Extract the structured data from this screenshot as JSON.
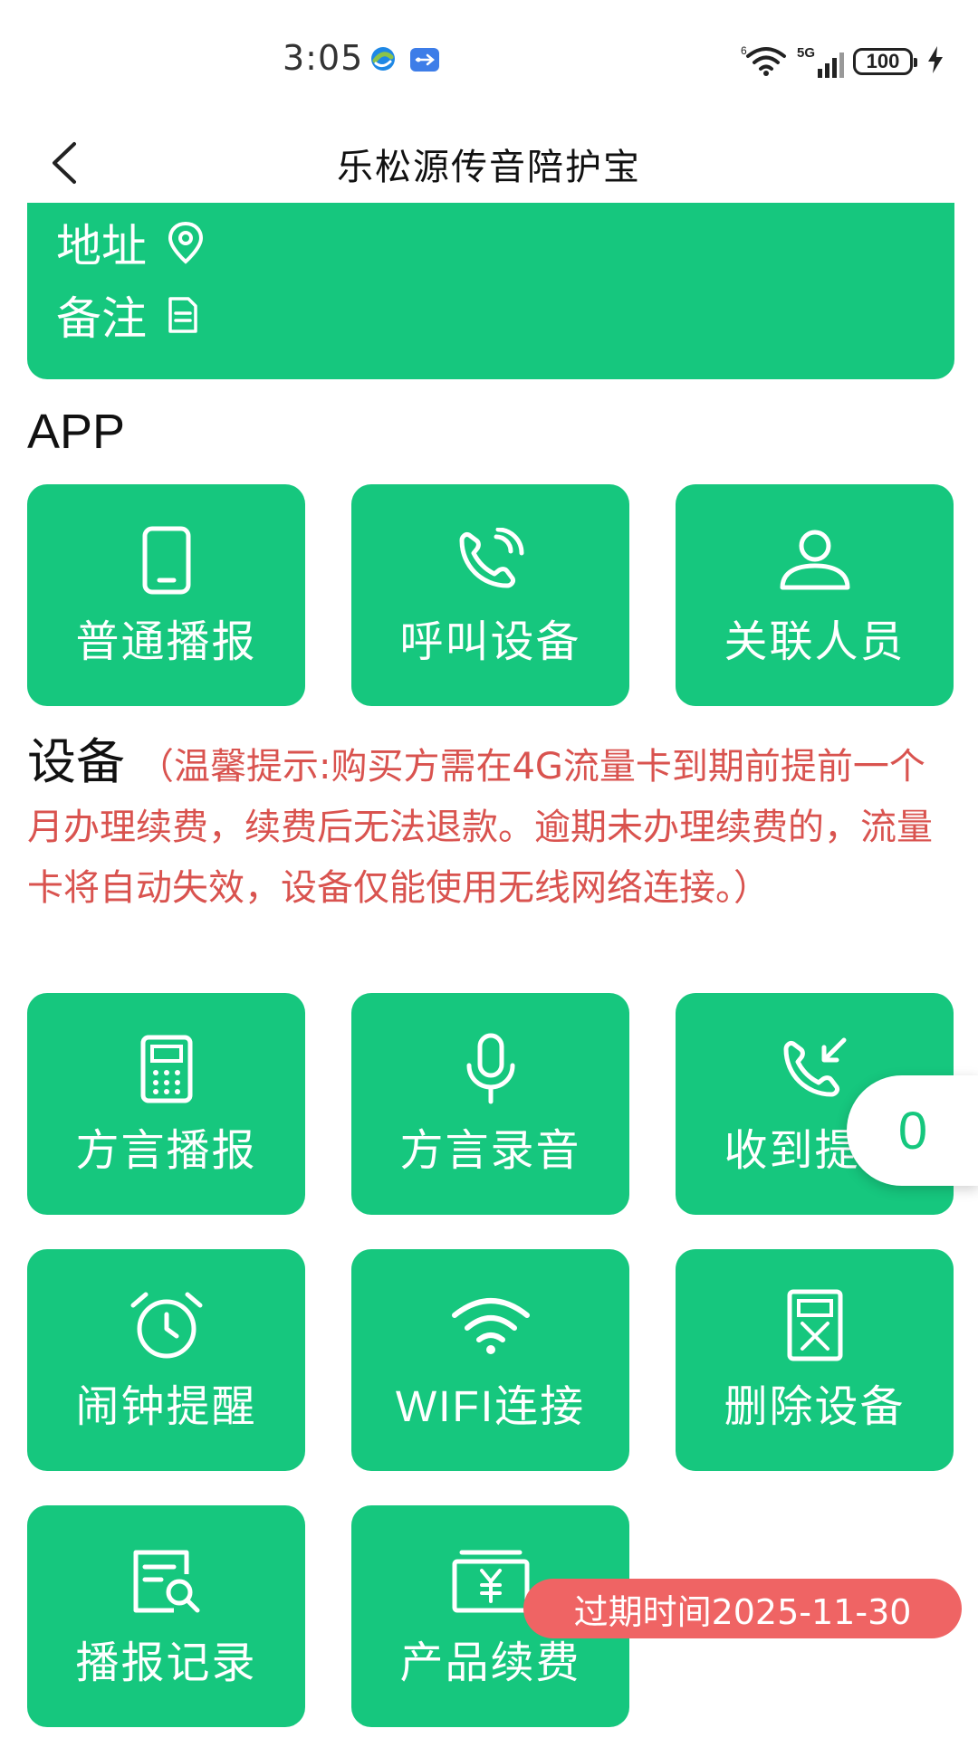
{
  "status_bar": {
    "time": "3:05",
    "network": "5G",
    "battery": "100"
  },
  "header": {
    "title": "乐松源传音陪护宝"
  },
  "info_card": {
    "address_label": "地址",
    "note_label": "备注"
  },
  "app_section": {
    "title": "APP",
    "tiles": [
      {
        "label": "普通播报",
        "icon": "phone-icon"
      },
      {
        "label": "呼叫设备",
        "icon": "call-icon"
      },
      {
        "label": "关联人员",
        "icon": "person-icon"
      }
    ]
  },
  "device_section": {
    "title": "设备",
    "notice": "（温馨提示:购买方需在4G流量卡到期前提前一个月办理续费，续费后无法退款。逾期未办理续费的，流量卡将自动失效，设备仅能使用无线网络连接。）",
    "tiles": [
      {
        "label": "方言播报",
        "icon": "device-keypad-icon"
      },
      {
        "label": "方言录音",
        "icon": "microphone-icon"
      },
      {
        "label": "收到提醒",
        "icon": "incoming-call-icon"
      },
      {
        "label": "闹钟提醒",
        "icon": "alarm-clock-icon"
      },
      {
        "label": "WIFI连接",
        "icon": "wifi-icon"
      },
      {
        "label": "删除设备",
        "icon": "delete-device-icon"
      },
      {
        "label": "播报记录",
        "icon": "search-record-icon"
      },
      {
        "label": "产品续费",
        "icon": "yuan-card-icon"
      }
    ]
  },
  "floating_badge": {
    "count": "0"
  },
  "expiry": {
    "text": "过期时间2025-11-30"
  },
  "colors": {
    "accent": "#16c77e",
    "notice": "#d9534f",
    "expiry": "#ef6464"
  }
}
